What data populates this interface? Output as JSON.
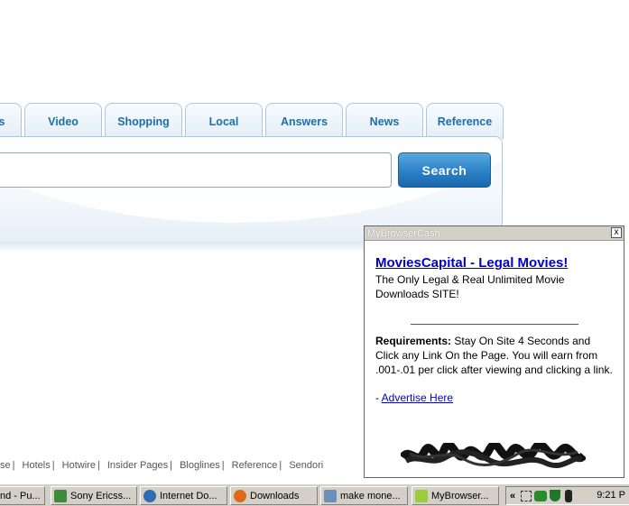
{
  "tabs": [
    {
      "label": "s"
    },
    {
      "label": "Video"
    },
    {
      "label": "Shopping"
    },
    {
      "label": "Local"
    },
    {
      "label": "Answers"
    },
    {
      "label": "News"
    },
    {
      "label": "Reference"
    }
  ],
  "search": {
    "button_label": "Search",
    "value": ""
  },
  "footer_links": [
    "se",
    "Hotels",
    "Hotwire",
    "Insider Pages",
    "Bloglines",
    "Reference",
    "Sendori"
  ],
  "popup": {
    "title": "MyBrowserCash",
    "close_label": "x",
    "headline": "MoviesCapital - Legal Movies!",
    "description": "The Only Legal & Real Unlimited Movie Downloads SITE!",
    "req_label": "Requirements:",
    "req_text": " Stay On Site 4 Seconds and Click any Link On the Page. You will earn from .001-.01 per click after viewing and clicking a link.",
    "advertise_prefix": "- ",
    "advertise_link": "Advertise Here"
  },
  "taskbar": {
    "tasks": [
      {
        "label": "nd - Pu..."
      },
      {
        "label": "Sony Ericss..."
      },
      {
        "label": "Internet Do..."
      },
      {
        "label": "Downloads"
      },
      {
        "label": "make mone..."
      },
      {
        "label": "MyBrowser..."
      }
    ],
    "tray_chevron": "«",
    "clock": "9:21 P"
  }
}
